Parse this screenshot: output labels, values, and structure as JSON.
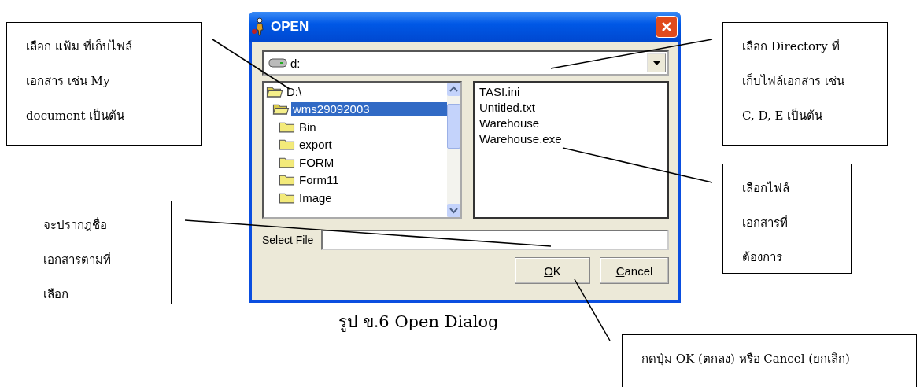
{
  "window": {
    "title": "OPEN"
  },
  "drive": {
    "value": "d:"
  },
  "folders": [
    {
      "label": "D:\\",
      "kind": "open",
      "selected": false,
      "children": [
        {
          "label": "wms29092003",
          "kind": "open",
          "selected": true,
          "children": [
            {
              "label": "Bin",
              "kind": "closed",
              "selected": false
            },
            {
              "label": "export",
              "kind": "closed",
              "selected": false
            },
            {
              "label": "FORM",
              "kind": "closed",
              "selected": false
            },
            {
              "label": "Form11",
              "kind": "closed",
              "selected": false
            },
            {
              "label": "Image",
              "kind": "closed",
              "selected": false
            }
          ]
        }
      ]
    }
  ],
  "files": [
    "TASI.ini",
    "Untitled.txt",
    "Warehouse",
    "Warehouse.exe"
  ],
  "select_file": {
    "label": "Select File"
  },
  "buttons": [
    {
      "label": "OK"
    },
    {
      "label": "Cancel"
    }
  ],
  "caption": "รูป ข.6 Open Dialog",
  "callouts": [
    {
      "text": "เลือก แฟ้ม ที่เก็บไฟล์\nเอกสาร เช่น My\ndocument เป็นต้น"
    },
    {
      "text": "จะปรากฎชื่อ\nเอกสารตามที่\nเลือก"
    },
    {
      "text": "เลือก Directory ที่\nเก็บไฟล์เอกสาร เช่น\nC, D, E เป็นต้น"
    },
    {
      "text": "เลือกไฟล์\nเอกสารที่\nต้องการ"
    },
    {
      "text": "กดปุ่ม OK (ตกลง) หรือ Cancel (ยกเลิก)"
    }
  ]
}
